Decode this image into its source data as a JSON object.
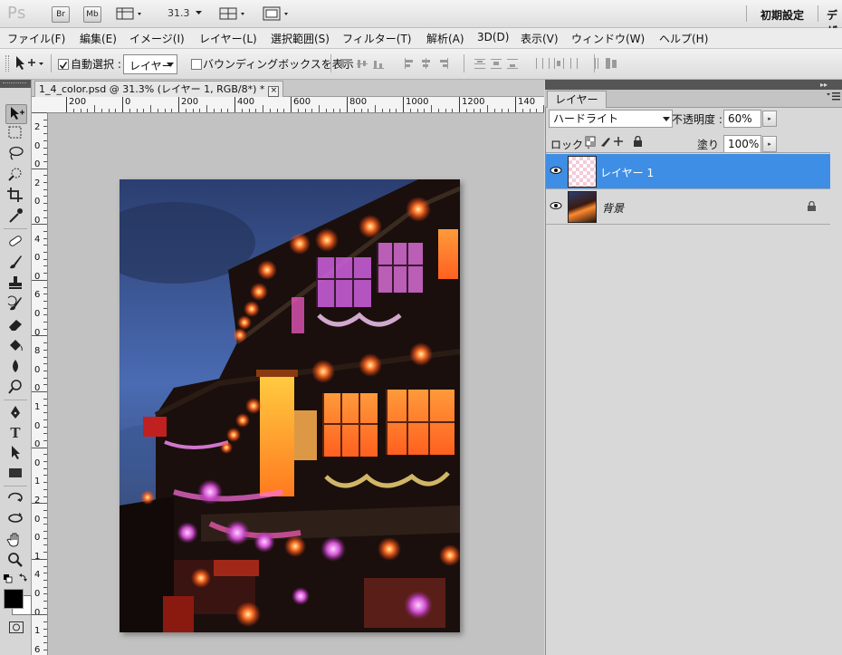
{
  "app": {
    "logo": "Ps",
    "bridge_label": "Br",
    "minibridge_label": "Mb",
    "zoom": "31.3",
    "workspace": "初期設定",
    "workspace_next": "デザ"
  },
  "menu": [
    "ファイル(F)",
    "編集(E)",
    "イメージ(I)",
    "レイヤー(L)",
    "選択範囲(S)",
    "フィルター(T)",
    "解析(A)",
    "3D(D)",
    "表示(V)",
    "ウィンドウ(W)",
    "ヘルプ(H)"
  ],
  "options": {
    "auto_select_label": "自動選択 :",
    "auto_select_target": "レイヤー",
    "bounding_box_label": "バウンディングボックスを表示"
  },
  "document": {
    "tab_title": "1_4_color.psd @ 31.3% (レイヤー 1, RGB/8*) *",
    "ruler_h": [
      "200",
      "0",
      "200",
      "400",
      "600",
      "800",
      "1000",
      "1200",
      "140"
    ],
    "ruler_v": [
      "2",
      "0",
      "0",
      "2",
      "0",
      "0",
      "4",
      "0",
      "0",
      "6",
      "0",
      "0",
      "8",
      "0",
      "0",
      "1",
      "0",
      "0",
      "0",
      "1",
      "2",
      "0",
      "0",
      "1",
      "4",
      "0",
      "0",
      "1",
      "6"
    ]
  },
  "layers_panel": {
    "tab": "レイヤー",
    "blend_mode": "ハードライト",
    "opacity_label": "不透明度 :",
    "opacity": "60%",
    "lock_label": "ロック :",
    "fill_label": "塗り :",
    "fill": "100%",
    "layers": [
      {
        "name": "レイヤー 1",
        "selected": true
      },
      {
        "name": "背景",
        "selected": false,
        "locked": true
      }
    ]
  },
  "colors": {
    "selection": "#3f8ee6",
    "foreground": "#000000",
    "background": "#ffffff"
  }
}
